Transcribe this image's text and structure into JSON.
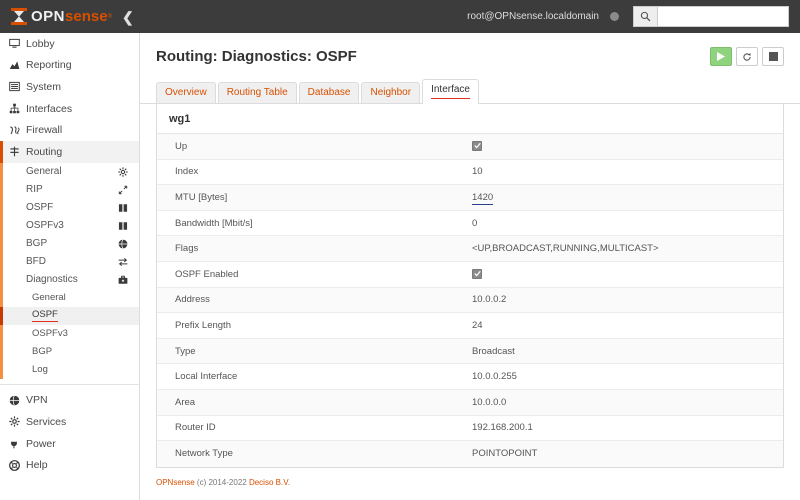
{
  "header": {
    "logo_opn": "OPN",
    "logo_sense": "sense",
    "logo_reg": "®",
    "collapse_icon": "chevron-left-icon",
    "username": "root@OPNsense.localdomain",
    "search_placeholder": "",
    "search_value": "",
    "search_icon": "search-icon"
  },
  "sidebar": {
    "items": [
      {
        "label": "Lobby",
        "icon": "desktop-icon",
        "active": false
      },
      {
        "label": "Reporting",
        "icon": "chart-area-icon",
        "active": false
      },
      {
        "label": "System",
        "icon": "sliders-icon",
        "active": false
      },
      {
        "label": "Interfaces",
        "icon": "sitemap-icon",
        "active": false
      },
      {
        "label": "Firewall",
        "icon": "brick-wall-icon",
        "active": false
      },
      {
        "label": "Routing",
        "icon": "road-sign-icon",
        "active": true
      }
    ],
    "routing_children": [
      {
        "label": "General",
        "icon": "gear-icon",
        "active": false
      },
      {
        "label": "RIP",
        "icon": "expand-icon",
        "active": false
      },
      {
        "label": "OSPF",
        "icon": "book-icon",
        "active": false
      },
      {
        "label": "OSPFv3",
        "icon": "book-icon",
        "active": false
      },
      {
        "label": "BGP",
        "icon": "globe-icon",
        "active": false
      },
      {
        "label": "BFD",
        "icon": "exchange-icon",
        "active": false
      },
      {
        "label": "Diagnostics",
        "icon": "briefcase-icon",
        "active": false
      }
    ],
    "diagnostics_children": [
      {
        "label": "General",
        "active": false
      },
      {
        "label": "OSPF",
        "active": true
      },
      {
        "label": "OSPFv3",
        "active": false
      },
      {
        "label": "BGP",
        "active": false
      },
      {
        "label": "Log",
        "active": false
      }
    ],
    "bottom_items": [
      {
        "label": "VPN",
        "icon": "globe-icon"
      },
      {
        "label": "Services",
        "icon": "gear-icon"
      },
      {
        "label": "Power",
        "icon": "plug-icon"
      },
      {
        "label": "Help",
        "icon": "life-ring-icon"
      }
    ]
  },
  "page": {
    "title": "Routing: Diagnostics: OSPF",
    "actions": [
      {
        "name": "play-button",
        "icon": "play-icon"
      },
      {
        "name": "refresh-button",
        "icon": "refresh-icon"
      },
      {
        "name": "stop-button",
        "icon": "stop-icon"
      }
    ],
    "tabs": [
      {
        "label": "Overview",
        "active": false
      },
      {
        "label": "Routing Table",
        "active": false
      },
      {
        "label": "Database",
        "active": false
      },
      {
        "label": "Neighbor",
        "active": false
      },
      {
        "label": "Interface",
        "active": true
      }
    ],
    "section_title": "wg1",
    "rows": [
      {
        "key": "Up",
        "value": "",
        "type": "checkbox",
        "checked": true
      },
      {
        "key": "Index",
        "value": "10",
        "type": "text"
      },
      {
        "key": "MTU [Bytes]",
        "value": "1420",
        "type": "selected-text"
      },
      {
        "key": "Bandwidth [Mbit/s]",
        "value": "0",
        "type": "text"
      },
      {
        "key": "Flags",
        "value": "<UP,BROADCAST,RUNNING,MULTICAST>",
        "type": "text"
      },
      {
        "key": "OSPF Enabled",
        "value": "",
        "type": "checkbox",
        "checked": true
      },
      {
        "key": "Address",
        "value": "10.0.0.2",
        "type": "text"
      },
      {
        "key": "Prefix Length",
        "value": "24",
        "type": "text"
      },
      {
        "key": "Type",
        "value": "Broadcast",
        "type": "text"
      },
      {
        "key": "Local Interface",
        "value": "10.0.0.255",
        "type": "text"
      },
      {
        "key": "Area",
        "value": "10.0.0.0",
        "type": "text"
      },
      {
        "key": "Router ID",
        "value": "192.168.200.1",
        "type": "text"
      },
      {
        "key": "Network Type",
        "value": "POINTOPOINT",
        "type": "text"
      }
    ]
  },
  "footer": {
    "brand": "OPNsense",
    "middle": " (c) 2014-2022 ",
    "company": "Deciso B.V."
  },
  "colors": {
    "brand_orange": "#d94f00",
    "header_dark": "#3c3c3c",
    "accent_red": "#e03020",
    "play_green": "#8fd37f",
    "selection_blue": "#2a3f8f"
  }
}
